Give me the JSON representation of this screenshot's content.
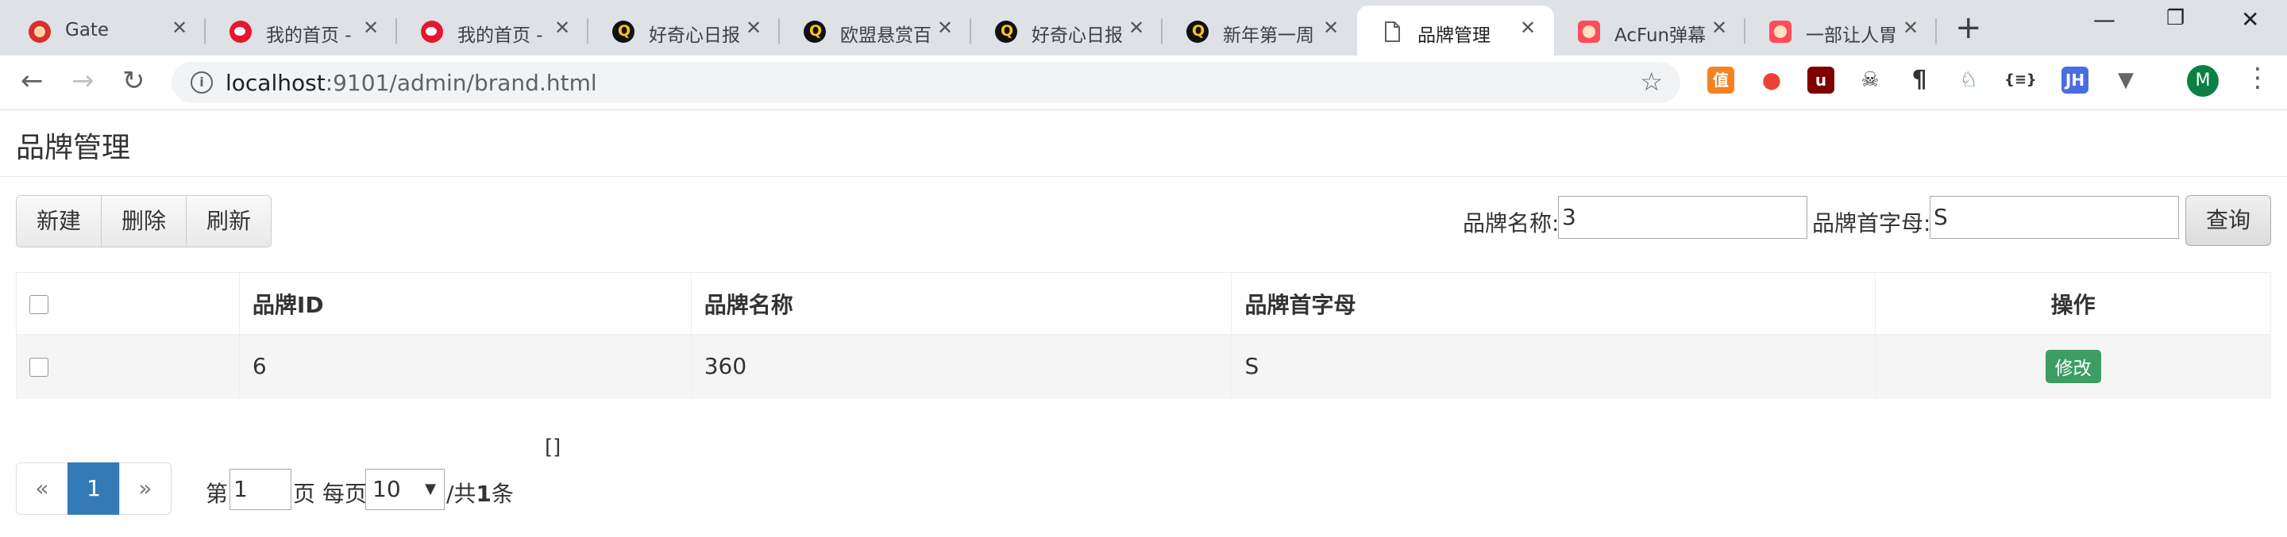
{
  "browser": {
    "tabs": [
      {
        "title": "Gate",
        "icon": "gate-icon"
      },
      {
        "title": "我的首页 - ",
        "icon": "weibo-icon"
      },
      {
        "title": "我的首页 - ",
        "icon": "weibo-icon"
      },
      {
        "title": "好奇心日报",
        "icon": "qdaily-icon"
      },
      {
        "title": "欧盟悬赏百",
        "icon": "qdaily-icon"
      },
      {
        "title": "好奇心日报",
        "icon": "qdaily-icon"
      },
      {
        "title": "新年第一周",
        "icon": "qdaily-icon"
      },
      {
        "title": "品牌管理",
        "icon": "document-icon"
      },
      {
        "title": "AcFun弹幕",
        "icon": "acfun-icon"
      },
      {
        "title": "一部让人胃",
        "icon": "acfun-icon"
      }
    ],
    "url_host": "localhost",
    "url_path": ":9101/admin/brand.html",
    "profile_initial": "M"
  },
  "page": {
    "title": "品牌管理",
    "buttons": {
      "new": "新建",
      "delete": "删除",
      "refresh": "刷新"
    },
    "search": {
      "name_label": "品牌名称:",
      "name_value": "3",
      "letter_label": "品牌首字母:",
      "letter_value": "S",
      "query_label": "查询"
    },
    "table": {
      "headers": [
        "品牌ID",
        "品牌名称",
        "品牌首字母",
        "操作"
      ],
      "rows": [
        {
          "id": "6",
          "name": "360",
          "letter": "S",
          "action": "修改"
        }
      ]
    },
    "debug_text": "[]",
    "pagination": {
      "prev": "«",
      "current": "1",
      "next": "»",
      "page_prefix": "第",
      "page_value": "1",
      "page_suffix": "页 每页",
      "page_size": "10",
      "total_prefix": "/共",
      "total_count": "1",
      "total_suffix": "条"
    }
  }
}
